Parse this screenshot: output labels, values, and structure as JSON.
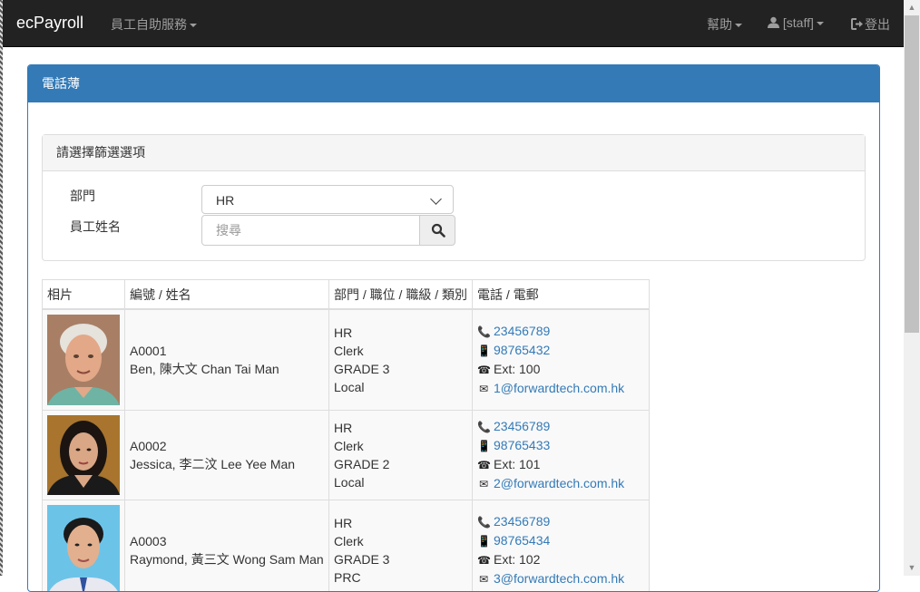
{
  "navbar": {
    "brand": "ecPayroll",
    "menu": "員工自助服務",
    "help": "幫助",
    "user": "[staff]",
    "logout": "登出"
  },
  "panel": {
    "title": "電話薄"
  },
  "filter": {
    "title": "請選擇篩選選項",
    "dept_label": "部門",
    "dept_value": "HR",
    "name_label": "員工姓名",
    "name_placeholder": "搜尋"
  },
  "table": {
    "headers": [
      "相片",
      "編號 / 姓名",
      "部門 / 職位 / 職級 / 類別",
      "電話 / 電郵"
    ],
    "rows": [
      {
        "id": "A0001",
        "name": "Ben, 陳大文 Chan Tai Man",
        "dept": "HR",
        "position": "Clerk",
        "grade": "GRADE 3",
        "type": "Local",
        "phone": "23456789",
        "mobile": "98765432",
        "ext": "Ext: 100",
        "email": "1@forwardtech.com.hk"
      },
      {
        "id": "A0002",
        "name": "Jessica, 李二汶 Lee Yee Man",
        "dept": "HR",
        "position": "Clerk",
        "grade": "GRADE 2",
        "type": "Local",
        "phone": "23456789",
        "mobile": "98765433",
        "ext": "Ext: 101",
        "email": "2@forwardtech.com.hk"
      },
      {
        "id": "A0003",
        "name": "Raymond, 黃三文 Wong Sam Man",
        "dept": "HR",
        "position": "Clerk",
        "grade": "GRADE 3",
        "type": "PRC",
        "phone": "23456789",
        "mobile": "98765434",
        "ext": "Ext: 102",
        "email": "3@forwardtech.com.hk"
      }
    ]
  },
  "colors": {
    "navbar": "#222222",
    "primary": "#337ab7",
    "link": "#337ab7"
  }
}
